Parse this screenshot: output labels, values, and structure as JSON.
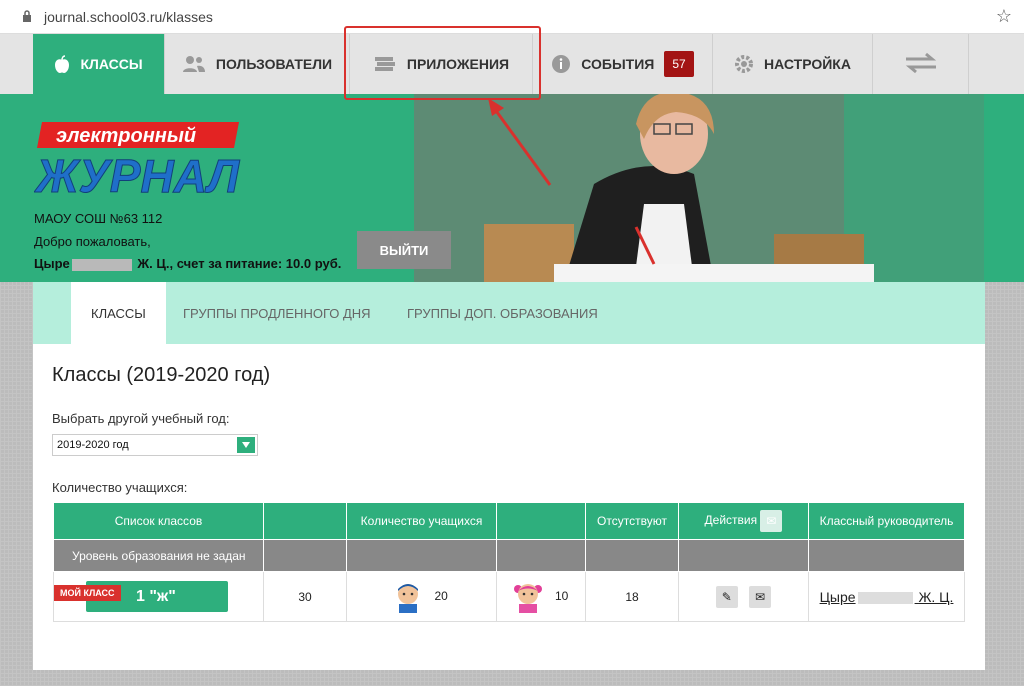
{
  "browser": {
    "url": "journal.school03.ru/klasses"
  },
  "nav": {
    "classes": "КЛАССЫ",
    "users": "ПОЛЬЗОВАТЕЛИ",
    "apps": "ПРИЛОЖЕНИЯ",
    "events": "СОБЫТИЯ",
    "events_count": "57",
    "settings": "НАСТРОЙКА"
  },
  "logo": {
    "line1": "электронный",
    "line2": "ЖУРНАЛ"
  },
  "header": {
    "school": "МАОУ СОШ №63 112",
    "welcome": "Добро пожаловать,",
    "user_prefix": "Цыре",
    "user_suffix": "Ж. Ц., счет за питание: 10.0 руб.",
    "exit": "ВЫЙТИ"
  },
  "subnav": {
    "tabs": [
      "КЛАССЫ",
      "ГРУППЫ ПРОДЛЕННОГО ДНЯ",
      "ГРУППЫ ДОП. ОБРАЗОВАНИЯ"
    ]
  },
  "page": {
    "title": "Классы (2019-2020 год)",
    "year_label": "Выбрать другой учебный год:",
    "year_value": "2019-2020 год",
    "count_label": "Количество учащихся:"
  },
  "table": {
    "headers": [
      "Список классов",
      "",
      "Количество учащихся",
      "",
      "Отсутствуют",
      "Действия",
      "Классный руководитель"
    ],
    "level_row": "Уровень образования не задан",
    "row": {
      "ribbon": "МОЙ КЛАСС",
      "class_name": "1 \"ж\"",
      "total": "30",
      "boys": "20",
      "girls": "10",
      "absent": "18",
      "teacher_prefix": "Цыре",
      "teacher_suffix": "Ж. Ц."
    }
  },
  "colors": {
    "accent": "#2eaf7d",
    "badge": "#a31414",
    "highlight": "#d9312d"
  }
}
